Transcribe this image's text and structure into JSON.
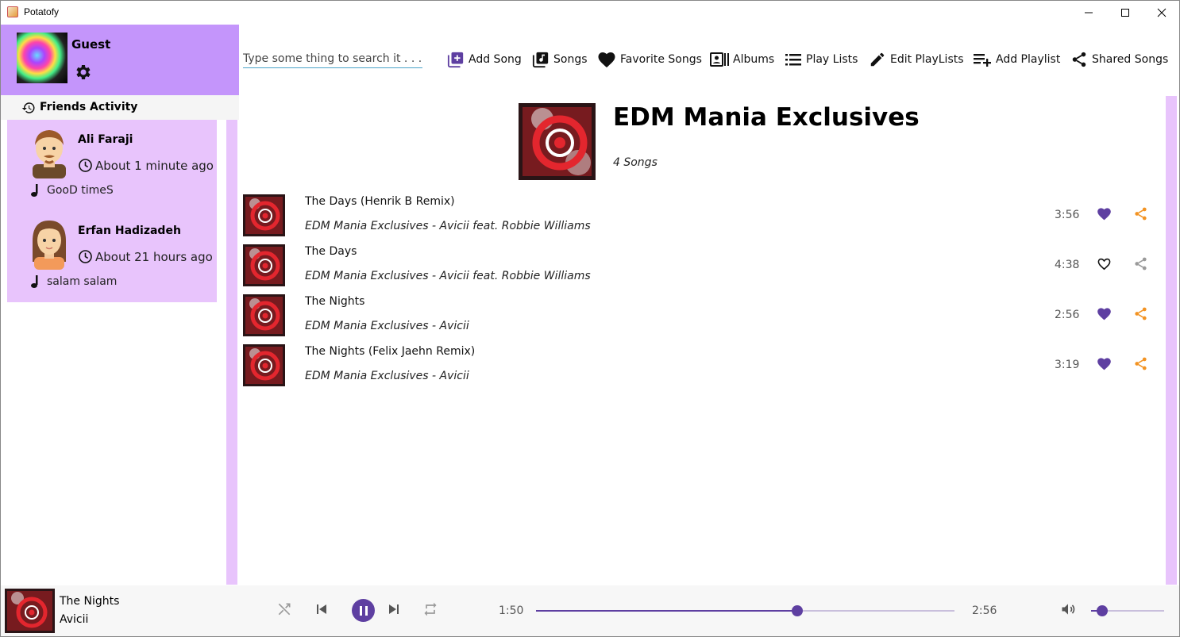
{
  "window": {
    "title": "Potatofy"
  },
  "profile": {
    "name": "Guest",
    "avatar_icon": "music-clef-avatar",
    "settings_icon": "gear-icon"
  },
  "friends": {
    "heading": "Friends Activity",
    "items": [
      {
        "name": "Ali Faraji",
        "time": "About 1 minute ago",
        "song": "GooD timeS",
        "avatar": "male-avatar"
      },
      {
        "name": "Erfan Hadizadeh",
        "time": "About 21 hours ago",
        "song": "salam salam",
        "avatar": "female-avatar"
      }
    ]
  },
  "toolbar": {
    "search_placeholder": "Type some thing to search it . . .",
    "items": [
      {
        "label": "Add Song",
        "icon": "add-box-icon"
      },
      {
        "label": "Songs",
        "icon": "library-music-icon"
      },
      {
        "label": "Favorite Songs",
        "icon": "heart-icon"
      },
      {
        "label": "Albums",
        "icon": "album-card-icon"
      },
      {
        "label": "Play Lists",
        "icon": "list-icon"
      },
      {
        "label": "Edit PlayLists",
        "icon": "pencil-icon"
      },
      {
        "label": "Add Playlist",
        "icon": "playlist-add-icon"
      },
      {
        "label": "Shared Songs",
        "icon": "share-icon"
      }
    ]
  },
  "album": {
    "title": "EDM Mania Exclusives",
    "count": "4 Songs",
    "songs": [
      {
        "title": "The Days (Henrik B Remix)",
        "subtitle": "EDM Mania Exclusives - Avicii feat. Robbie Williams",
        "duration": "3:56",
        "favorite": true,
        "shared": true
      },
      {
        "title": "The Days",
        "subtitle": "EDM Mania Exclusives - Avicii feat. Robbie Williams",
        "duration": "4:38",
        "favorite": false,
        "shared": false
      },
      {
        "title": "The Nights",
        "subtitle": "EDM Mania Exclusives - Avicii",
        "duration": "2:56",
        "favorite": true,
        "shared": true
      },
      {
        "title": "The Nights (Felix Jaehn Remix)",
        "subtitle": "EDM Mania Exclusives - Avicii",
        "duration": "3:19",
        "favorite": true,
        "shared": true
      }
    ]
  },
  "player": {
    "title": "The Nights",
    "artist": "Avicii",
    "current_time": "1:50",
    "total_time": "2:56",
    "progress": 0.624,
    "volume": 0.15
  },
  "colors": {
    "accent": "#5e3fa1",
    "profile_bg": "#c495fb",
    "panel_bg": "#e8c4fc",
    "share": "#f39322"
  }
}
